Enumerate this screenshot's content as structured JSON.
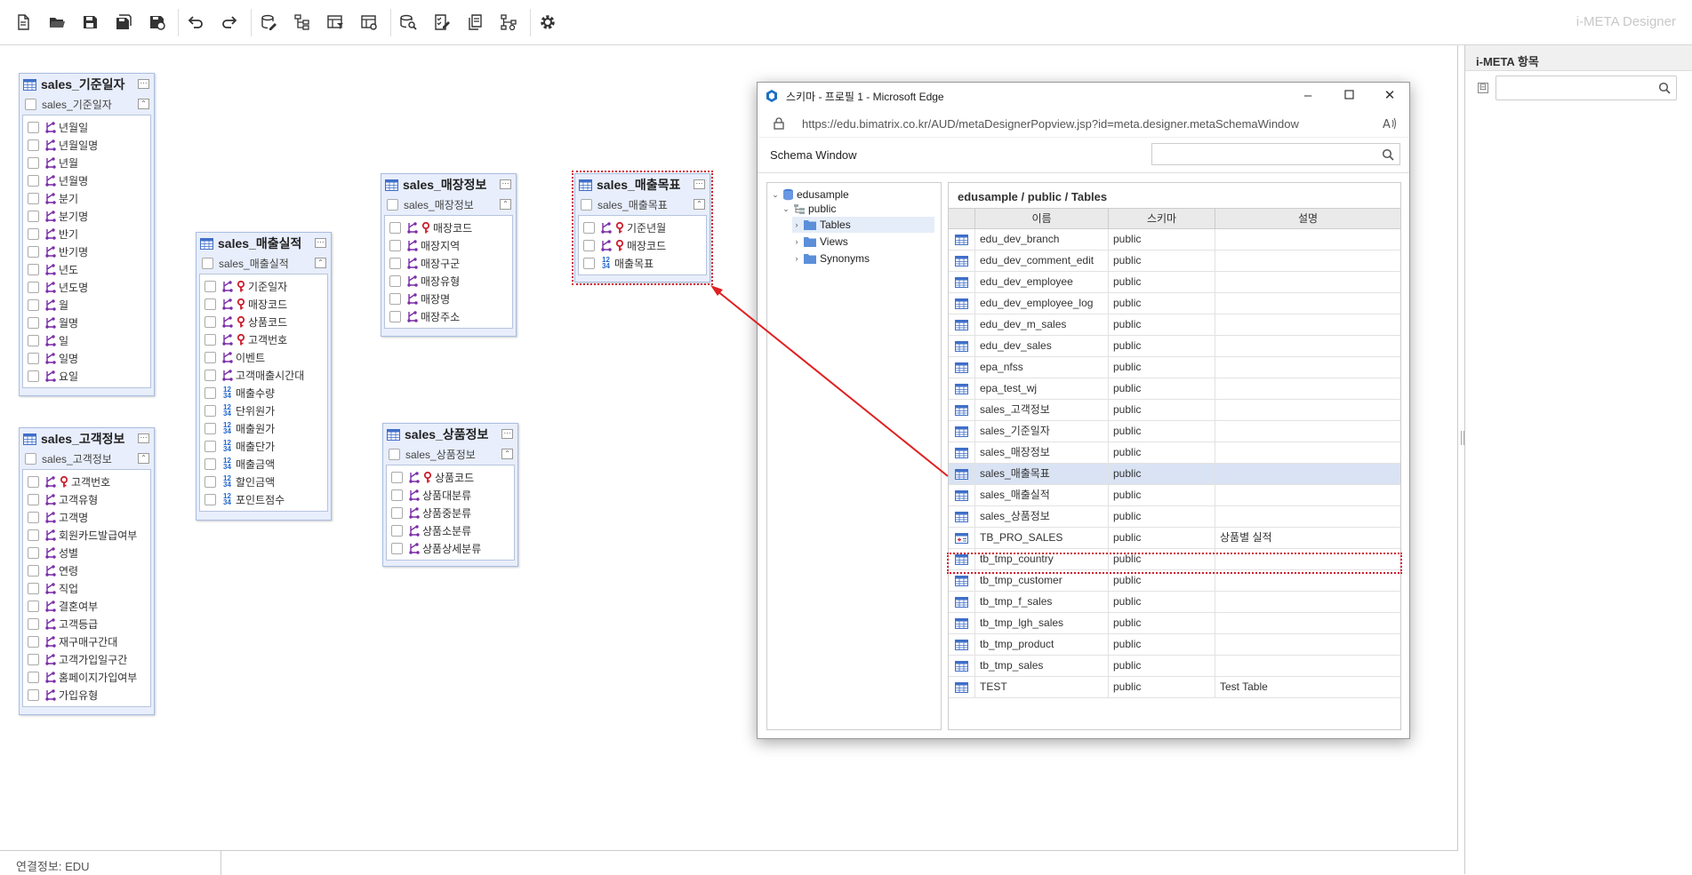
{
  "app": {
    "title": "i-META Designer"
  },
  "toolbar": {
    "buttons": [
      "new-file-icon",
      "open-folder-icon",
      "save-icon",
      "save-all-icon",
      "save-as-icon",
      "undo-icon",
      "redo-icon",
      "db-edit-icon",
      "tree-structure-icon",
      "table-filter-icon",
      "table-settings-icon",
      "db-search-icon",
      "checklist-icon",
      "document-copy-icon",
      "hierarchy-icon",
      "settings-gear-icon"
    ]
  },
  "right_panel": {
    "title": "i-META 항목",
    "collapse_symbol": "⊟",
    "search_placeholder": ""
  },
  "status": {
    "connection": "연결정보: EDU"
  },
  "tables": [
    {
      "title": "sales_기준일자",
      "subtitle": "sales_기준일자",
      "columns": [
        {
          "name": "년월일",
          "type": "rel"
        },
        {
          "name": "년월일명",
          "type": "rel"
        },
        {
          "name": "년월",
          "type": "rel"
        },
        {
          "name": "년월명",
          "type": "rel"
        },
        {
          "name": "분기",
          "type": "rel"
        },
        {
          "name": "분기명",
          "type": "rel"
        },
        {
          "name": "반기",
          "type": "rel"
        },
        {
          "name": "반기명",
          "type": "rel"
        },
        {
          "name": "년도",
          "type": "rel"
        },
        {
          "name": "년도명",
          "type": "rel"
        },
        {
          "name": "월",
          "type": "rel"
        },
        {
          "name": "월명",
          "type": "rel"
        },
        {
          "name": "일",
          "type": "rel"
        },
        {
          "name": "일명",
          "type": "rel"
        },
        {
          "name": "요일",
          "type": "rel"
        }
      ]
    },
    {
      "title": "sales_고객정보",
      "subtitle": "sales_고객정보",
      "columns": [
        {
          "name": "고객번호",
          "type": "key"
        },
        {
          "name": "고객유형",
          "type": "rel"
        },
        {
          "name": "고객명",
          "type": "rel"
        },
        {
          "name": "회원카드발급여부",
          "type": "rel"
        },
        {
          "name": "성별",
          "type": "rel"
        },
        {
          "name": "연령",
          "type": "rel"
        },
        {
          "name": "직업",
          "type": "rel"
        },
        {
          "name": "결혼여부",
          "type": "rel"
        },
        {
          "name": "고객등급",
          "type": "rel"
        },
        {
          "name": "재구매구간대",
          "type": "rel"
        },
        {
          "name": "고객가입일구간",
          "type": "rel"
        },
        {
          "name": "홈페이지가입여부",
          "type": "rel"
        },
        {
          "name": "가입유형",
          "type": "rel"
        }
      ]
    },
    {
      "title": "sales_매출실적",
      "subtitle": "sales_매출실적",
      "columns": [
        {
          "name": "기준일자",
          "type": "key"
        },
        {
          "name": "매장코드",
          "type": "key"
        },
        {
          "name": "상품코드",
          "type": "key"
        },
        {
          "name": "고객번호",
          "type": "key"
        },
        {
          "name": "이벤트",
          "type": "rel"
        },
        {
          "name": "고객매출시간대",
          "type": "rel"
        },
        {
          "name": "매출수량",
          "type": "num"
        },
        {
          "name": "단위원가",
          "type": "num"
        },
        {
          "name": "매출원가",
          "type": "num"
        },
        {
          "name": "매출단가",
          "type": "num"
        },
        {
          "name": "매출금액",
          "type": "num"
        },
        {
          "name": "할인금액",
          "type": "num"
        },
        {
          "name": "포인트점수",
          "type": "num"
        }
      ]
    },
    {
      "title": "sales_매장정보",
      "subtitle": "sales_매장정보",
      "columns": [
        {
          "name": "매장코드",
          "type": "key"
        },
        {
          "name": "매장지역",
          "type": "rel"
        },
        {
          "name": "매장구군",
          "type": "rel"
        },
        {
          "name": "매장유형",
          "type": "rel"
        },
        {
          "name": "매장명",
          "type": "rel"
        },
        {
          "name": "매장주소",
          "type": "rel"
        }
      ]
    },
    {
      "title": "sales_상품정보",
      "subtitle": "sales_상품정보",
      "columns": [
        {
          "name": "상품코드",
          "type": "key"
        },
        {
          "name": "상품대분류",
          "type": "rel"
        },
        {
          "name": "상품중분류",
          "type": "rel"
        },
        {
          "name": "상품소분류",
          "type": "rel"
        },
        {
          "name": "상품상세분류",
          "type": "rel"
        }
      ]
    },
    {
      "title": "sales_매출목표",
      "subtitle": "sales_매출목표",
      "columns": [
        {
          "name": "기준년월",
          "type": "key"
        },
        {
          "name": "매장코드",
          "type": "key"
        },
        {
          "name": "매출목표",
          "type": "num"
        }
      ]
    }
  ],
  "popup": {
    "window_title": "스키마 - 프로필 1 - Microsoft Edge",
    "url": "https://edu.bimatrix.co.kr/AUD/metaDesignerPopview.jsp?id=meta.designer.metaSchemaWindow",
    "schema_title": "Schema Window",
    "tree": {
      "root": "edusample",
      "schema": "public",
      "children": [
        "Tables",
        "Views",
        "Synonyms"
      ]
    },
    "grid_path": "edusample / public / Tables",
    "columns": [
      "이름",
      "스키마",
      "설명"
    ],
    "rows": [
      {
        "name": "edu_dev_branch",
        "schema": "public",
        "desc": "",
        "icon": "table"
      },
      {
        "name": "edu_dev_comment_edit",
        "schema": "public",
        "desc": "",
        "icon": "table"
      },
      {
        "name": "edu_dev_employee",
        "schema": "public",
        "desc": "",
        "icon": "table"
      },
      {
        "name": "edu_dev_employee_log",
        "schema": "public",
        "desc": "",
        "icon": "table"
      },
      {
        "name": "edu_dev_m_sales",
        "schema": "public",
        "desc": "",
        "icon": "table"
      },
      {
        "name": "edu_dev_sales",
        "schema": "public",
        "desc": "",
        "icon": "table"
      },
      {
        "name": "epa_nfss",
        "schema": "public",
        "desc": "",
        "icon": "table"
      },
      {
        "name": "epa_test_wj",
        "schema": "public",
        "desc": "",
        "icon": "table"
      },
      {
        "name": "sales_고객정보",
        "schema": "public",
        "desc": "",
        "icon": "table"
      },
      {
        "name": "sales_기준일자",
        "schema": "public",
        "desc": "",
        "icon": "table"
      },
      {
        "name": "sales_매장정보",
        "schema": "public",
        "desc": "",
        "icon": "table"
      },
      {
        "name": "sales_매출목표",
        "schema": "public",
        "desc": "",
        "icon": "table",
        "selected": true
      },
      {
        "name": "sales_매출실적",
        "schema": "public",
        "desc": "",
        "icon": "table"
      },
      {
        "name": "sales_상품정보",
        "schema": "public",
        "desc": "",
        "icon": "table"
      },
      {
        "name": "TB_PRO_SALES",
        "schema": "public",
        "desc": "상품별 실적",
        "icon": "table-special"
      },
      {
        "name": "tb_tmp_country",
        "schema": "public",
        "desc": "",
        "icon": "table"
      },
      {
        "name": "tb_tmp_customer",
        "schema": "public",
        "desc": "",
        "icon": "table"
      },
      {
        "name": "tb_tmp_f_sales",
        "schema": "public",
        "desc": "",
        "icon": "table"
      },
      {
        "name": "tb_tmp_lgh_sales",
        "schema": "public",
        "desc": "",
        "icon": "table"
      },
      {
        "name": "tb_tmp_product",
        "schema": "public",
        "desc": "",
        "icon": "table"
      },
      {
        "name": "tb_tmp_sales",
        "schema": "public",
        "desc": "",
        "icon": "table"
      },
      {
        "name": "TEST",
        "schema": "public",
        "desc": "Test Table",
        "icon": "table"
      }
    ]
  },
  "colors": {
    "accent_red": "#d21f2f",
    "table_border": "#a9bde3",
    "table_bg": "#e8eefb",
    "selection_row": "#d9e3f4",
    "key_icon": "#cc1f2f",
    "relation_icon": "#7a2ea8",
    "num_icon": "#2266cc"
  }
}
